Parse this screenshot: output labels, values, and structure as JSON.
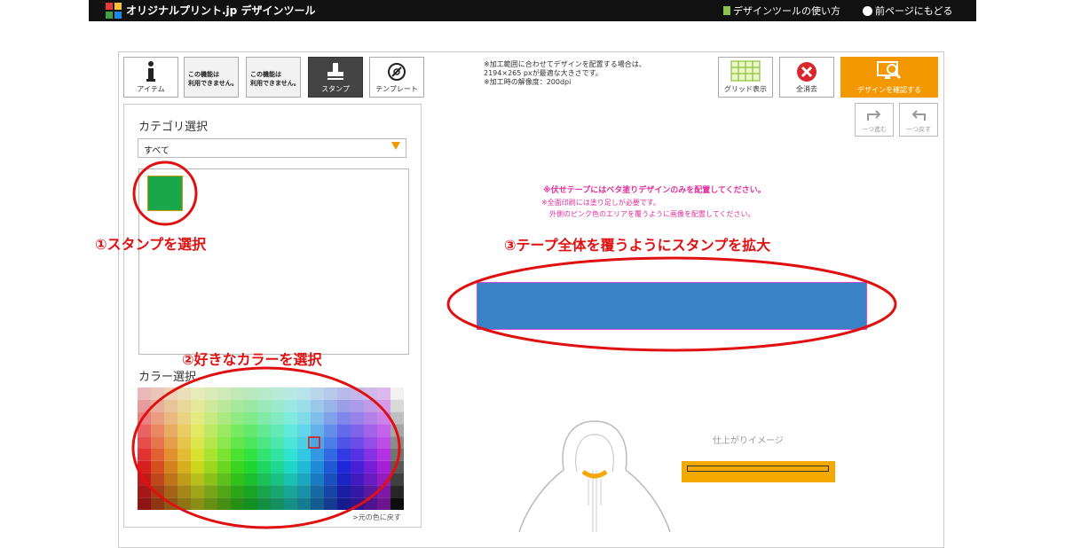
{
  "topbar": {
    "brand": "オリジナルプリント.jp デザインツール",
    "help_link": "デザインツールの使い方",
    "back_link": "前ページにもどる"
  },
  "toolbar": {
    "item_label": "アイテム",
    "disabled_line1": "この機能は",
    "disabled_line2": "利用できません。",
    "stamp_label": "スタンプ",
    "template_label": "テンプレート"
  },
  "left_panel": {
    "category_title": "カテゴリ選択",
    "category_value": "すべて",
    "color_title": "カラー選択",
    "reset_color": ">元の色に戻す"
  },
  "notice": [
    "※加工範囲に合わせてデザインを配置する場合は、",
    "2194×265 pxが最適な大きさです。",
    "※加工時の解像度：200dpi"
  ],
  "right_toolbar": {
    "grid_label": "グリッド表示",
    "clear_label": "全消去",
    "confirm_label": "デザインを確認する",
    "redo_label": "一つ進む",
    "undo_label": "一つ戻す"
  },
  "canvas": {
    "warning_1": "※伏せテープにはベタ塗りデザインのみを配置してください。",
    "warning_2": "※全面印刷には塗り足しが必要です。",
    "warning_3": "外側のピンク色のエリアを覆うように画像を配置してください。",
    "tape_color": "#3a82c6",
    "preview_label": "仕上がりイメージ"
  },
  "annotations": {
    "step1": "①スタンプを選択",
    "step2": "②好きなカラーを選択",
    "step3": "③テープ全体を覆うようにスタンプを拡大"
  },
  "colors": {
    "accent": "#f39800",
    "annotation": "#e01010",
    "stamp_green": "#1aa64a",
    "warning_pink": "#e0309c"
  },
  "icons": [
    "info-icon",
    "stamp-icon",
    "template-icon",
    "grid-icon",
    "clear-icon",
    "confirm-icon",
    "redo-icon",
    "undo-icon"
  ]
}
